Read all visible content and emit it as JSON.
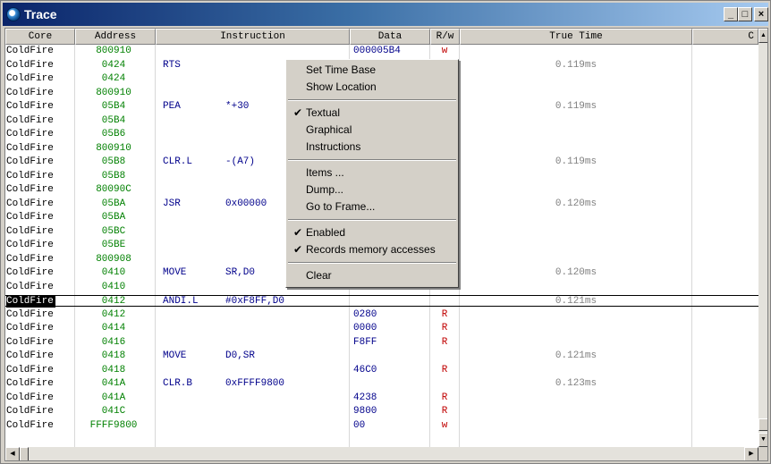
{
  "window": {
    "title": "Trace"
  },
  "header": [
    "Core",
    "Address",
    "Instruction",
    "Data",
    "R/w",
    "True Time",
    "C"
  ],
  "rows": [
    {
      "core": "ColdFire",
      "addr": "800910",
      "instr": "",
      "oper": "",
      "data": "000005B4",
      "rw": "w",
      "time": ""
    },
    {
      "core": "ColdFire",
      "addr": "0424",
      "instr": "RTS",
      "oper": "",
      "data": "",
      "rw": "",
      "time": "0.119ms"
    },
    {
      "core": "ColdFire",
      "addr": "0424",
      "instr": "",
      "oper": "",
      "data": "",
      "rw": "",
      "time": ""
    },
    {
      "core": "ColdFire",
      "addr": "800910",
      "instr": "",
      "oper": "",
      "data": "",
      "rw": "",
      "time": ""
    },
    {
      "core": "ColdFire",
      "addr": "05B4",
      "instr": "PEA",
      "oper": "*+30",
      "data": "",
      "rw": "",
      "time": "0.119ms"
    },
    {
      "core": "ColdFire",
      "addr": "05B4",
      "instr": "",
      "oper": "",
      "data": "",
      "rw": "",
      "time": ""
    },
    {
      "core": "ColdFire",
      "addr": "05B6",
      "instr": "",
      "oper": "",
      "data": "",
      "rw": "",
      "time": ""
    },
    {
      "core": "ColdFire",
      "addr": "800910",
      "instr": "",
      "oper": "",
      "data": "",
      "rw": "",
      "time": ""
    },
    {
      "core": "ColdFire",
      "addr": "05B8",
      "instr": "CLR.L",
      "oper": "-(A7)",
      "data": "",
      "rw": "",
      "time": "0.119ms"
    },
    {
      "core": "ColdFire",
      "addr": "05B8",
      "instr": "",
      "oper": "",
      "data": "",
      "rw": "",
      "time": ""
    },
    {
      "core": "ColdFire",
      "addr": "80090C",
      "instr": "",
      "oper": "",
      "data": "",
      "rw": "",
      "time": ""
    },
    {
      "core": "ColdFire",
      "addr": "05BA",
      "instr": "JSR",
      "oper": "0x00000",
      "data": "",
      "rw": "",
      "time": "0.120ms"
    },
    {
      "core": "ColdFire",
      "addr": "05BA",
      "instr": "",
      "oper": "",
      "data": "",
      "rw": "",
      "time": ""
    },
    {
      "core": "ColdFire",
      "addr": "05BC",
      "instr": "",
      "oper": "",
      "data": "",
      "rw": "",
      "time": ""
    },
    {
      "core": "ColdFire",
      "addr": "05BE",
      "instr": "",
      "oper": "",
      "data": "",
      "rw": "",
      "time": ""
    },
    {
      "core": "ColdFire",
      "addr": "800908",
      "instr": "",
      "oper": "",
      "data": "",
      "rw": "",
      "time": ""
    },
    {
      "core": "ColdFire",
      "addr": "0410",
      "instr": "MOVE",
      "oper": "SR,D0",
      "data": "",
      "rw": "",
      "time": "0.120ms"
    },
    {
      "core": "ColdFire",
      "addr": "0410",
      "instr": "",
      "oper": "",
      "data": "40C0",
      "rw": "R",
      "time": ""
    },
    {
      "core": "ColdFire",
      "addr": "0412",
      "instr": "ANDI.L",
      "oper": "#0xF8FF,D0",
      "data": "",
      "rw": "",
      "time": "0.121ms",
      "selected": true
    },
    {
      "core": "ColdFire",
      "addr": "0412",
      "instr": "",
      "oper": "",
      "data": "0280",
      "rw": "R",
      "time": ""
    },
    {
      "core": "ColdFire",
      "addr": "0414",
      "instr": "",
      "oper": "",
      "data": "0000",
      "rw": "R",
      "time": ""
    },
    {
      "core": "ColdFire",
      "addr": "0416",
      "instr": "",
      "oper": "",
      "data": "F8FF",
      "rw": "R",
      "time": ""
    },
    {
      "core": "ColdFire",
      "addr": "0418",
      "instr": "MOVE",
      "oper": "D0,SR",
      "data": "",
      "rw": "",
      "time": "0.121ms"
    },
    {
      "core": "ColdFire",
      "addr": "0418",
      "instr": "",
      "oper": "",
      "data": "46C0",
      "rw": "R",
      "time": ""
    },
    {
      "core": "ColdFire",
      "addr": "041A",
      "instr": "CLR.B",
      "oper": "0xFFFF9800",
      "data": "",
      "rw": "",
      "time": "0.123ms"
    },
    {
      "core": "ColdFire",
      "addr": "041A",
      "instr": "",
      "oper": "",
      "data": "4238",
      "rw": "R",
      "time": ""
    },
    {
      "core": "ColdFire",
      "addr": "041C",
      "instr": "",
      "oper": "",
      "data": "9800",
      "rw": "R",
      "time": ""
    },
    {
      "core": "ColdFire",
      "addr": "FFFF9800",
      "instr": "",
      "oper": "",
      "data": "00",
      "rw": "w",
      "time": ""
    }
  ],
  "context_menu": {
    "items": [
      {
        "label": "Set Time Base",
        "checked": false
      },
      {
        "label": "Show Location",
        "checked": false
      },
      {
        "sep": true
      },
      {
        "label": "Textual",
        "checked": true
      },
      {
        "label": "Graphical",
        "checked": false
      },
      {
        "label": "Instructions",
        "checked": false
      },
      {
        "sep": true
      },
      {
        "label": "Items ...",
        "checked": false
      },
      {
        "label": "Dump...",
        "checked": false
      },
      {
        "label": "Go to Frame...",
        "checked": false
      },
      {
        "sep": true
      },
      {
        "label": "Enabled",
        "checked": true
      },
      {
        "label": "Records memory accesses",
        "checked": true
      },
      {
        "sep": true
      },
      {
        "label": "Clear",
        "checked": false
      }
    ]
  },
  "icons": {
    "window": "app-icon",
    "minimize": "minimize-icon",
    "maximize": "maximize-icon",
    "close": "close-icon",
    "check": "check-icon"
  }
}
